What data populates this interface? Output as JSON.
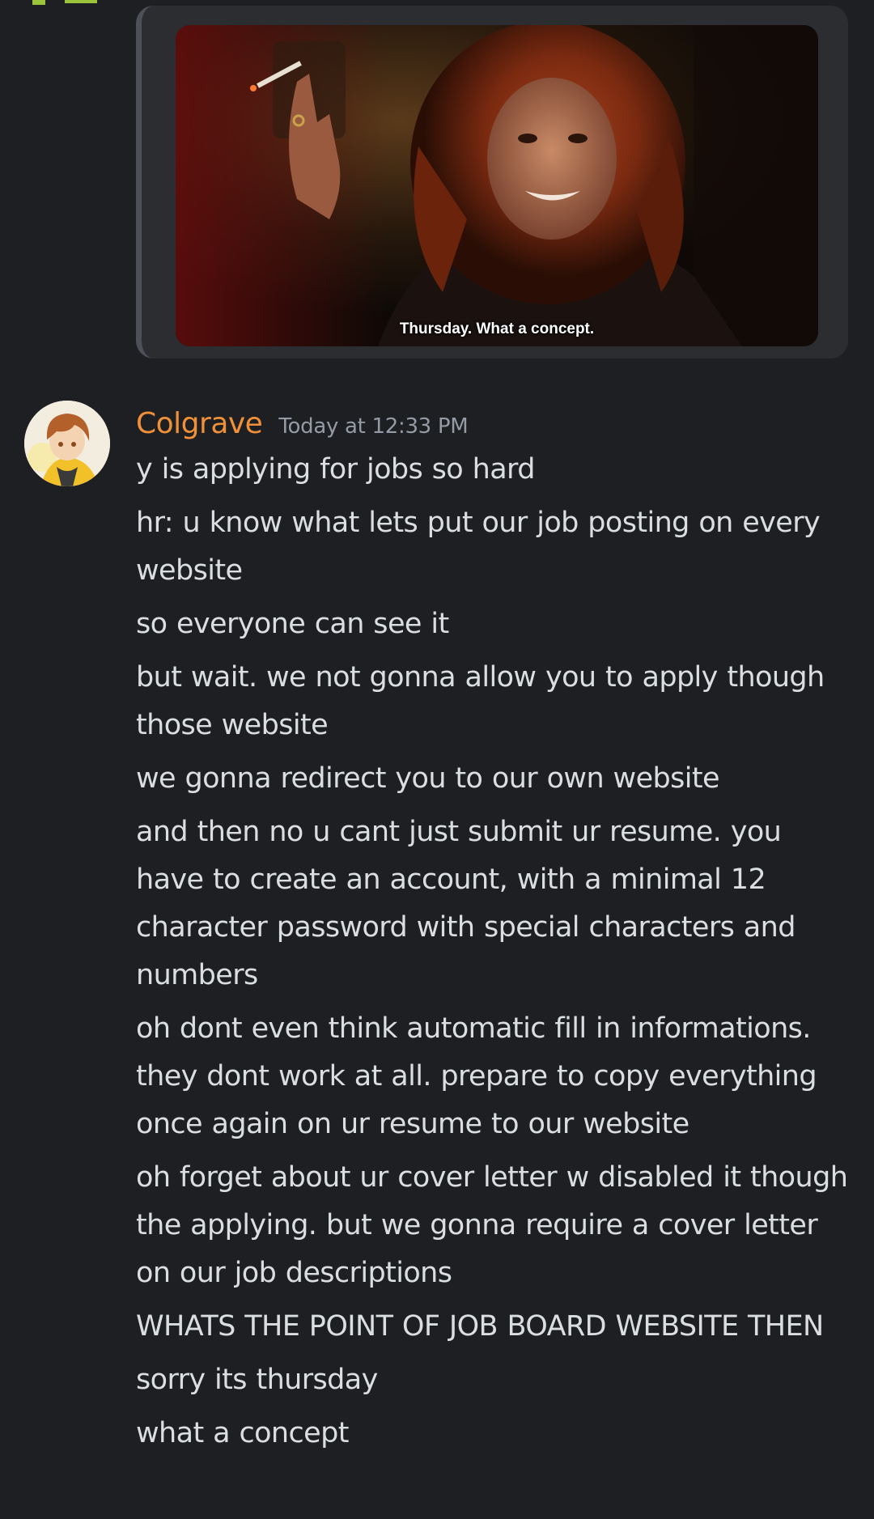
{
  "embed": {
    "subtitle": "Thursday. What a concept."
  },
  "message": {
    "username": "Colgrave",
    "timestamp": "Today at 12:33 PM",
    "lines": [
      "y is applying for jobs so hard",
      "hr: u know what lets put our job posting on every website",
      "so everyone can see it",
      "but wait. we not gonna allow you to apply though those website",
      "we gonna redirect you to our own website",
      "and then no u cant just submit ur resume. you have to create an account, with a minimal 12 character password with special characters and numbers",
      "oh dont even think automatic fill in informations. they dont work at all. prepare to copy everything once again on ur resume to our website",
      "oh forget about ur cover letter w disabled it though the applying. but we gonna require a cover letter on our job descriptions",
      "WHATS THE POINT OF JOB BOARD WEBSITE THEN",
      "sorry its thursday",
      "what a concept"
    ]
  },
  "colors": {
    "background": "#1e1f22",
    "embed_background": "#2b2d31",
    "embed_border": "#4e5058",
    "username": "#f0913a",
    "timestamp": "#949ba4",
    "text": "#dbdee1"
  }
}
